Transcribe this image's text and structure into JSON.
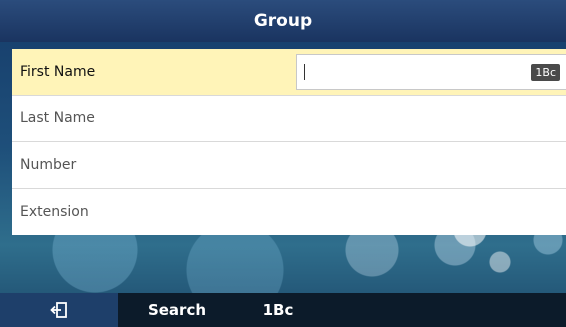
{
  "header": {
    "title": "Group"
  },
  "form": {
    "fields": [
      {
        "label": "First Name",
        "value": "",
        "input_mode": "1Bc"
      },
      {
        "label": "Last Name"
      },
      {
        "label": "Number"
      },
      {
        "label": "Extension"
      }
    ]
  },
  "softkeys": {
    "back_icon": "back-icon",
    "search": "Search",
    "input_mode": "1Bc"
  },
  "colors": {
    "title_bar": "#1f3c6b",
    "selected_row": "#fff4b8",
    "softkey_bar": "#0c1b2a",
    "active_softkey": "#1e3f6a"
  }
}
